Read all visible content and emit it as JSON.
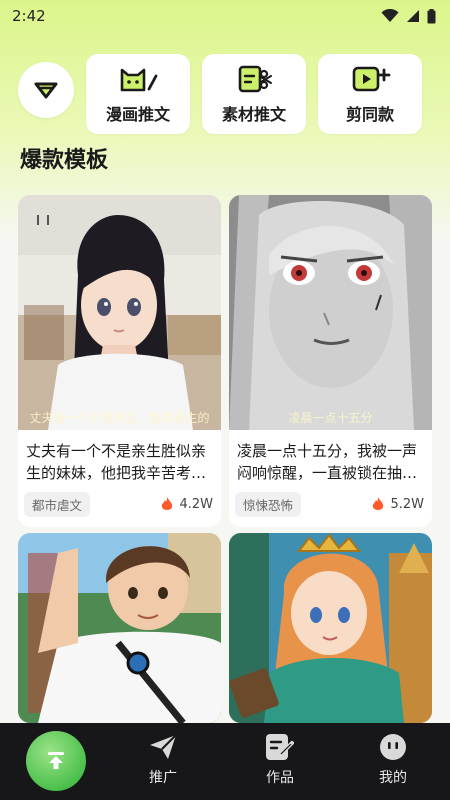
{
  "status_bar": {
    "time": "2:42"
  },
  "quick_actions": [
    {
      "label": "漫画推文",
      "icon": "cat-pen-icon"
    },
    {
      "label": "素材推文",
      "icon": "film-scissors-icon"
    },
    {
      "label": "剪同款",
      "icon": "video-plus-icon"
    }
  ],
  "section": {
    "title": "爆款模板"
  },
  "templates": [
    {
      "overlay": "丈夫有一个不是亲生，胜似亲生的",
      "description": "丈夫有一个不是亲生胜似亲生的妹妹，他把我辛苦考…",
      "tag": "都市虐文",
      "heat": "4.2W"
    },
    {
      "overlay": "凌晨一点十五分",
      "description": "凌晨一点十五分，我被一声闷响惊醒，一直被锁在抽…",
      "tag": "惊悚恐怖",
      "heat": "5.2W"
    },
    {
      "overlay": "",
      "description": "",
      "tag": "",
      "heat": ""
    },
    {
      "overlay": "",
      "description": "",
      "tag": "",
      "heat": ""
    }
  ],
  "bottom_nav": {
    "items": [
      {
        "label": "推广",
        "icon": "paper-plane-icon"
      },
      {
        "label": "作品",
        "icon": "document-edit-icon"
      },
      {
        "label": "我的",
        "icon": "face-icon"
      }
    ]
  },
  "colors": {
    "accent": "#cdf06a",
    "nav_bg": "#17171a",
    "upload_green": "#4cc04c",
    "flame": "#ff5a2a"
  }
}
